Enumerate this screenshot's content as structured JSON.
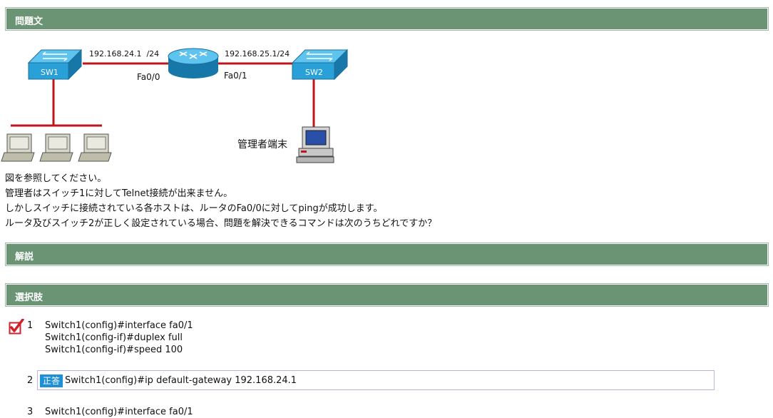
{
  "sections": {
    "question_title": "問題文",
    "explanation_title": "解説",
    "choices_title": "選択肢"
  },
  "diagram": {
    "sw1_label": "SW1",
    "sw2_label": "SW2",
    "ip_left": "192.168.24.1  /24",
    "ip_right": "192.168.25.1/24",
    "port_left": "Fa0/0",
    "port_right": "Fa0/1",
    "admin_label": "管理者端末"
  },
  "question": {
    "lines": [
      "図を参照してください。",
      "管理者はスイッチ1に対してTelnet接続が出来ません。",
      "しかしスイッチに接続されている各ホストは、ルータのFa0/0に対してpingが成功します。",
      "ルータ及びスイッチ2が正しく設定されている場合、問題を解決できるコマンドは次のうちどれですか？"
    ]
  },
  "choices": [
    {
      "num": "1",
      "lines": [
        "Switch1(config)#interface fa0/1",
        "Switch1(config-if)#duplex full",
        "Switch1(config-if)#speed 100"
      ]
    },
    {
      "num": "2",
      "badge": "正答",
      "lines": [
        "Switch1(config)#ip default-gateway 192.168.24.1"
      ]
    },
    {
      "num": "3",
      "lines": [
        "Switch1(config)#interface fa0/1"
      ]
    }
  ],
  "colors": {
    "header_bg": "#6a9474",
    "link_red": "#c0141c",
    "switch_blue": "#2aa0d8",
    "badge_blue": "#1e90d6"
  }
}
